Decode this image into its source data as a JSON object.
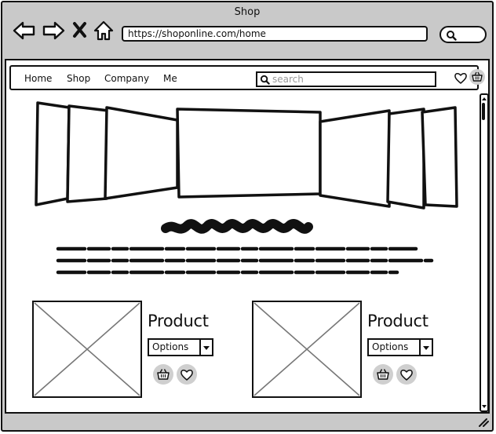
{
  "window": {
    "title": "Shop"
  },
  "browser": {
    "url": "https://shoponline.com/home"
  },
  "site": {
    "menu": [
      {
        "label": "Home"
      },
      {
        "label": "Shop"
      },
      {
        "label": "Company"
      },
      {
        "label": "Me"
      }
    ],
    "search": {
      "placeholder": "search",
      "value": ""
    }
  },
  "icons": {
    "back": "arrow-left-icon",
    "forward": "arrow-right-icon",
    "stop": "x-icon",
    "home": "home-icon",
    "search": "search-icon",
    "wishlist": "heart-icon",
    "cart": "basket-icon"
  },
  "products": [
    {
      "title": "Product",
      "option": "Options"
    },
    {
      "title": "Product",
      "option": "Options"
    }
  ],
  "colors": {
    "stroke": "#111111",
    "chrome": "#c9c9c9",
    "button_fill": "#cfcfcf"
  }
}
